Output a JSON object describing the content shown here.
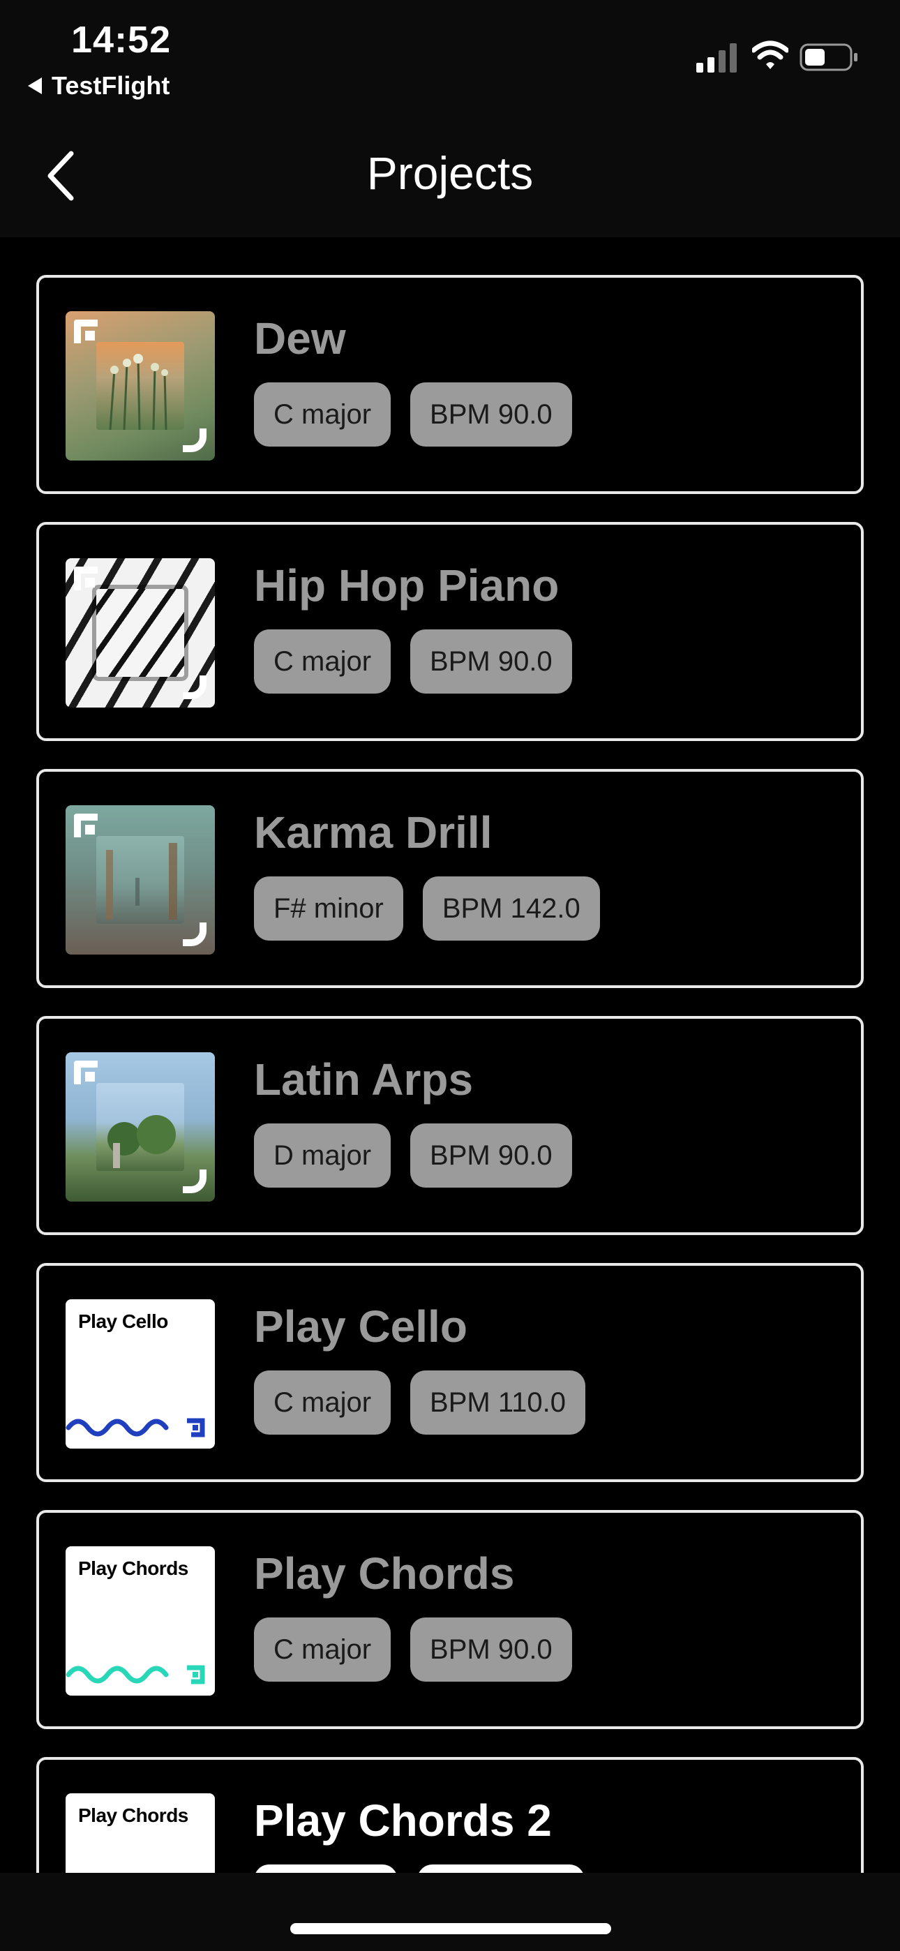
{
  "status_bar": {
    "time": "14:52",
    "back_app_label": "TestFlight",
    "icons": [
      "signal-icon",
      "wifi-icon",
      "battery-icon"
    ]
  },
  "nav": {
    "title": "Projects",
    "back_icon": "chevron-left-icon"
  },
  "projects": [
    {
      "title": "Dew",
      "key": "C major",
      "bpm": "BPM 90.0",
      "thumbnail": "flowers-photo",
      "colors": [
        "#d7935a",
        "#6d7f5f"
      ]
    },
    {
      "title": "Hip Hop Piano",
      "key": "C major",
      "bpm": "BPM 90.0",
      "thumbnail": "piano-photo",
      "colors": [
        "#e9e9e9",
        "#1c1c1c"
      ]
    },
    {
      "title": "Karma Drill",
      "key": "F# minor",
      "bpm": "BPM 142.0",
      "thumbnail": "foggy-city-photo",
      "colors": [
        "#7fa59d",
        "#5b534c"
      ]
    },
    {
      "title": "Latin Arps",
      "key": "D major",
      "bpm": "BPM 90.0",
      "thumbnail": "coastal-trees-photo",
      "colors": [
        "#9fc4e2",
        "#4f6d40"
      ]
    },
    {
      "title": "Play Cello",
      "key": "C major",
      "bpm": "BPM 110.0",
      "thumbnail": "play-cello-cover",
      "thumb_label": "Play Cello",
      "wave_color": "#1f3fbf"
    },
    {
      "title": "Play Chords",
      "key": "C major",
      "bpm": "BPM 90.0",
      "thumbnail": "play-chords-cover",
      "thumb_label": "Play Chords",
      "wave_color": "#28d6b8"
    },
    {
      "title": "Play Chords 2",
      "key": "",
      "bpm": "",
      "thumbnail": "play-chords-cover",
      "thumb_label": "Play Chords",
      "wave_color": "#28d6b8"
    }
  ]
}
